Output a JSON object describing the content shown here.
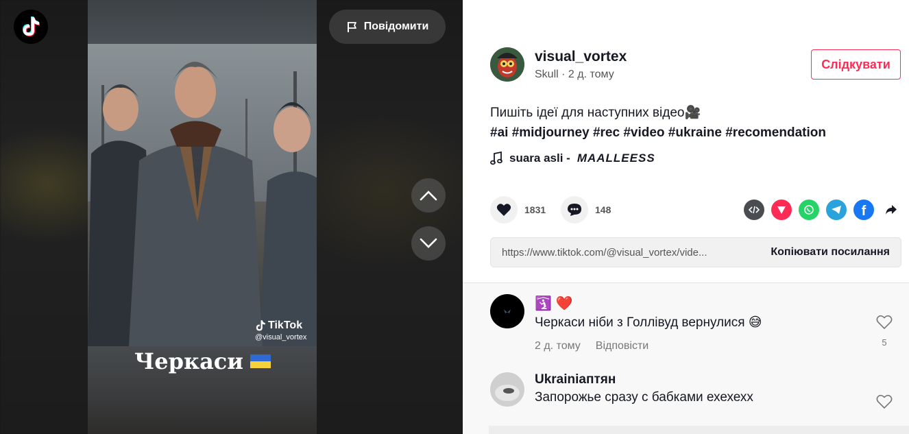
{
  "header": {
    "report_label": "Повідомити"
  },
  "video": {
    "watermark_brand": "TikTok",
    "watermark_handle": "@visual_vortex",
    "caption": "Черкаси"
  },
  "author": {
    "username": "visual_vortex",
    "subline": "Skull · 2 д. тому",
    "follow_label": "Слідкувати"
  },
  "post": {
    "description": "Пишіть ідеї для наступних відео",
    "hashtags": "#ai #midjourney #rec #video #ukraine #recomendation",
    "music_name": "suara asli -",
    "music_artist": "MAALLEESS"
  },
  "actions": {
    "likes": "1831",
    "comments": "148"
  },
  "share": {
    "icons": [
      "embed-icon",
      "send-icon",
      "whatsapp-icon",
      "telegram-icon",
      "facebook-icon",
      "share-arrow-icon"
    ],
    "link": "https://www.tiktok.com/@visual_vortex/vide...",
    "copy_label": "Копіювати посилання"
  },
  "comments": [
    {
      "user_emojis": [
        "🛐",
        "❤️"
      ],
      "text": "Черкаси ніби з Голлівуд вернулися 😅",
      "time": "2 д. тому",
      "reply_label": "Відповісти",
      "like_count": "5"
    },
    {
      "username": "Ukrainiaптян",
      "text": "Запорожье сразу с бабками ехехехх"
    }
  ],
  "colors": {
    "accent": "#fe2c55",
    "text": "#161823",
    "muted": "#777777"
  }
}
